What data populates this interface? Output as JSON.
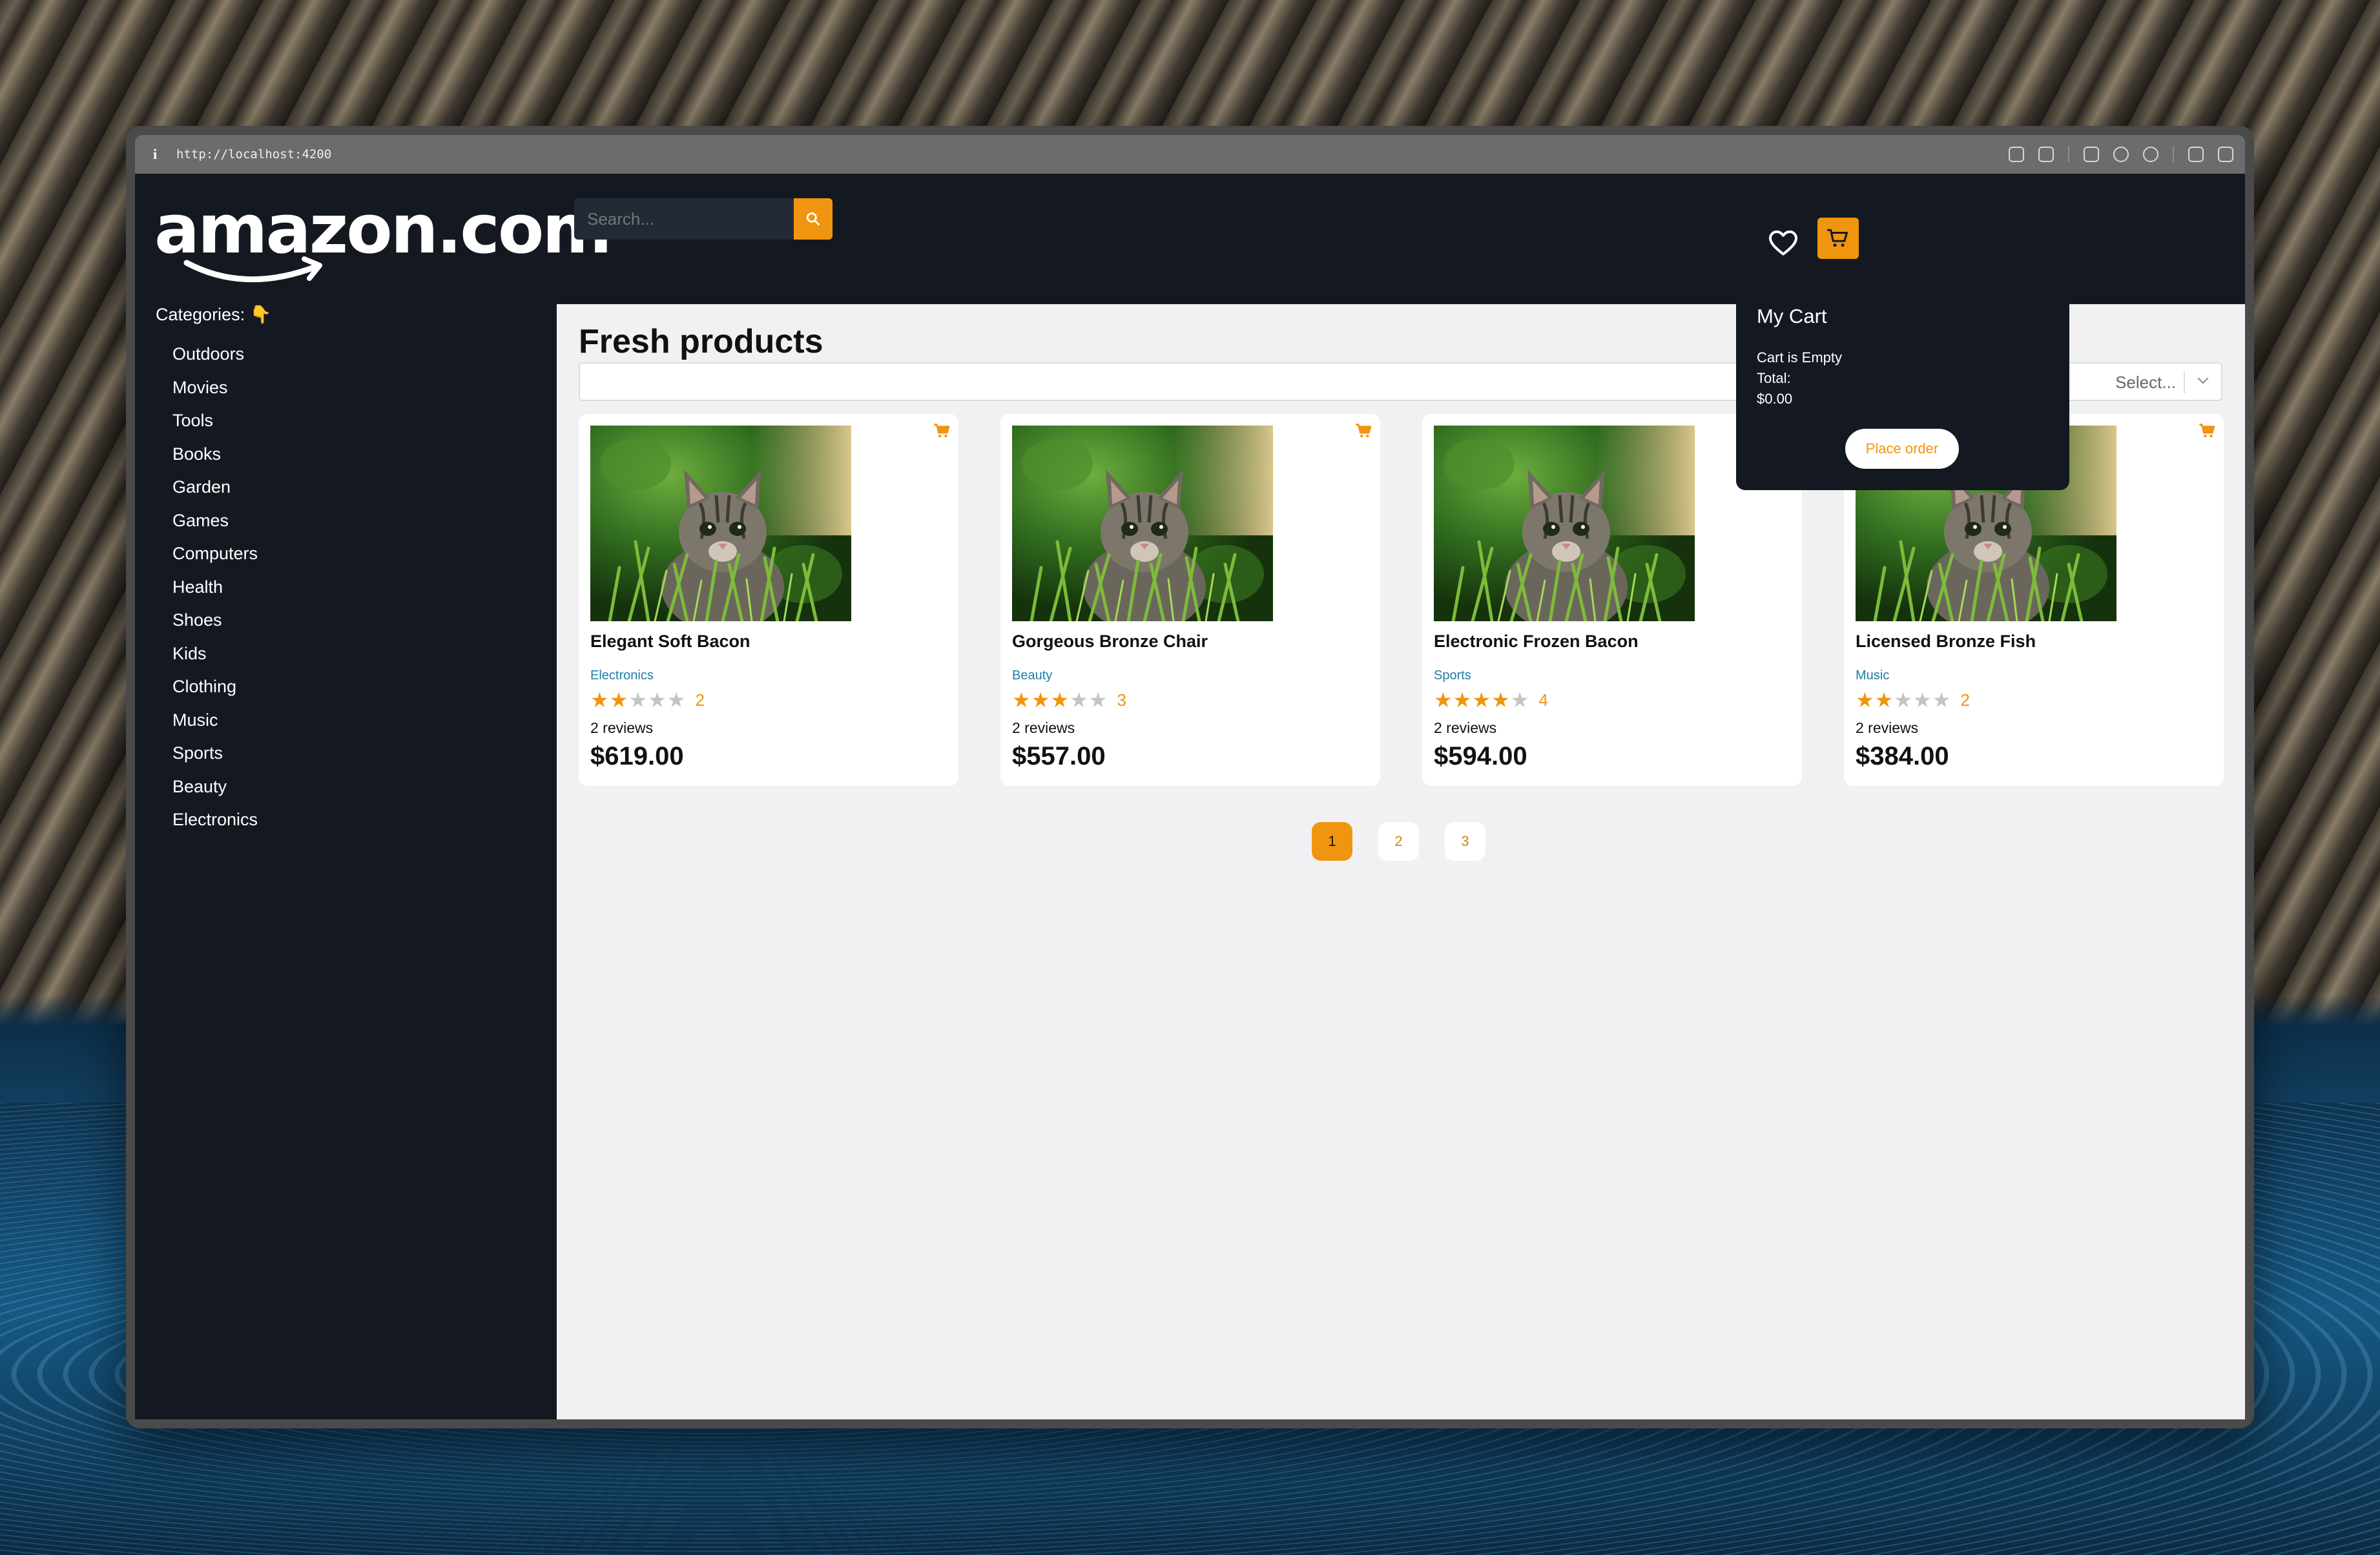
{
  "browser": {
    "url": "http://localhost:4200"
  },
  "header": {
    "logo": "amazon.com",
    "search_placeholder": "Search..."
  },
  "sidebar": {
    "title": "Categories: 👇",
    "items": [
      "Outdoors",
      "Movies",
      "Tools",
      "Books",
      "Garden",
      "Games",
      "Computers",
      "Health",
      "Shoes",
      "Kids",
      "Clothing",
      "Music",
      "Sports",
      "Beauty",
      "Electronics"
    ]
  },
  "main": {
    "title": "Fresh products",
    "select_placeholder": "Select..."
  },
  "products": [
    {
      "name": "Elegant Soft Bacon",
      "category": "Electronics",
      "rating": 2,
      "rating_text": "2",
      "reviews": "2 reviews",
      "price": "$619.00"
    },
    {
      "name": "Gorgeous Bronze Chair",
      "category": "Beauty",
      "rating": 3,
      "rating_text": "3",
      "reviews": "2 reviews",
      "price": "$557.00"
    },
    {
      "name": "Electronic Frozen Bacon",
      "category": "Sports",
      "rating": 4,
      "rating_text": "4",
      "reviews": "2 reviews",
      "price": "$594.00"
    },
    {
      "name": "Licensed Bronze Fish",
      "category": "Music",
      "rating": 2,
      "rating_text": "2",
      "reviews": "2 reviews",
      "price": "$384.00"
    }
  ],
  "pagination": {
    "pages": [
      "1",
      "2",
      "3"
    ],
    "current": "1"
  },
  "cart": {
    "title": "My Cart",
    "empty_text": "Cart is Empty",
    "total_label": "Total:",
    "total_value": "$0.00",
    "order_button": "Place order"
  },
  "colors": {
    "accent": "#f0950f",
    "dark": "#141921",
    "category_link": "#1e7fa8"
  }
}
